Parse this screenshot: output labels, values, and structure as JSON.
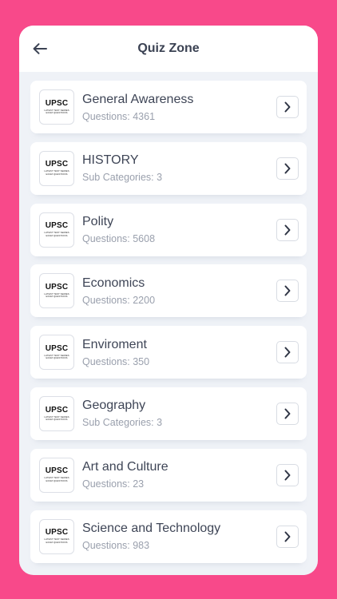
{
  "header": {
    "title": "Quiz Zone",
    "back_icon": "arrow-left-icon"
  },
  "logo": {
    "main": "UPSC",
    "sub": "LATEST TEST SERIES EXAM QUESTIONS"
  },
  "colors": {
    "background": "#f8498a",
    "screen": "#eff2f7",
    "card": "#ffffff",
    "title": "#3b4253",
    "subtext": "#9aa0ad"
  },
  "categories": [
    {
      "name": "General Awareness",
      "subtitle": "Questions: 4361"
    },
    {
      "name": "HISTORY",
      "subtitle": "Sub Categories: 3"
    },
    {
      "name": "Polity",
      "subtitle": "Questions: 5608"
    },
    {
      "name": "Economics",
      "subtitle": "Questions: 2200"
    },
    {
      "name": "Enviroment",
      "subtitle": "Questions: 350"
    },
    {
      "name": "Geography",
      "subtitle": "Sub Categories: 3"
    },
    {
      "name": "Art and Culture",
      "subtitle": "Questions: 23"
    },
    {
      "name": "Science and Technology",
      "subtitle": "Questions: 983"
    }
  ]
}
